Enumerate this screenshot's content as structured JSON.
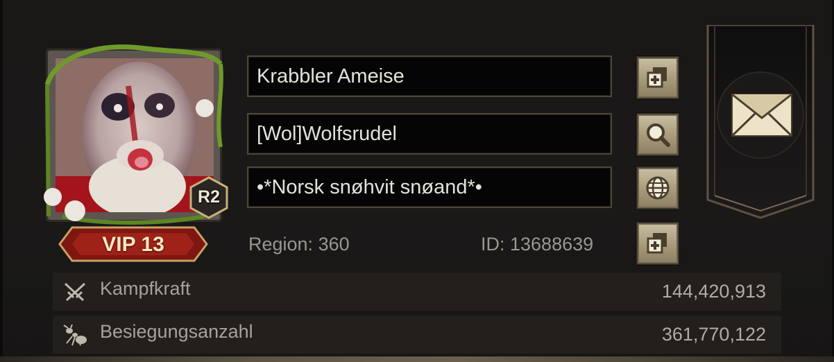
{
  "profile": {
    "name": "Krabbler Ameise",
    "alliance": "[Wol]Wolfsrudel",
    "motto": "•*Norsk snøhvit snøand*•",
    "region_label": "Region: 360",
    "id_label": "ID: 13688639",
    "rank": "R2",
    "vip": "VIP 13"
  },
  "stats": [
    {
      "label": "Kampfkraft",
      "value": "144,420,913",
      "icon": "crossed-swords-icon"
    },
    {
      "label": "Besiegungsanzahl",
      "value": "361,770,122",
      "icon": "ant-icon"
    }
  ],
  "icons": {
    "copy_name": "copy-icon",
    "search_alliance": "magnifier-icon",
    "language": "globe-icon",
    "copy_id": "copy-icon",
    "mail": "envelope-icon"
  },
  "colors": {
    "background": "#191817",
    "gold_button": "#b7aa8c",
    "vip_red": "#8a1a14",
    "frame_vine": "#5e8a2a"
  }
}
